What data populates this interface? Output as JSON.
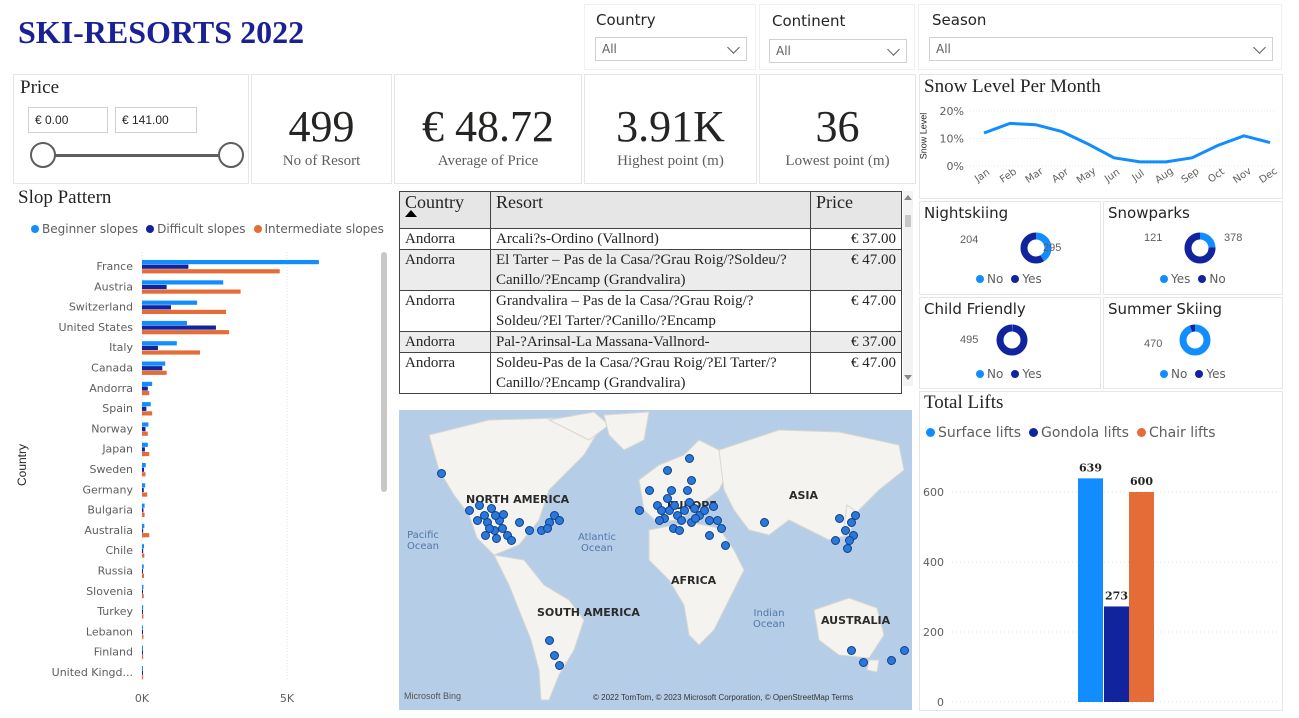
{
  "header": {
    "title": "SKI-RESORTS 2022"
  },
  "filters": [
    {
      "label": "Country",
      "value": "All"
    },
    {
      "label": "Continent",
      "value": "All"
    },
    {
      "label": "Season",
      "value": "All"
    }
  ],
  "price_slicer": {
    "label": "Price",
    "min": "€ 0.00",
    "max": "€ 141.00"
  },
  "kpis": [
    {
      "value": "499",
      "label": "No of Resort"
    },
    {
      "value": "€ 48.72",
      "label": "Average of Price"
    },
    {
      "value": "3.91K",
      "label": "Highest point (m)"
    },
    {
      "value": "36",
      "label": "Lowest point (m)"
    }
  ],
  "colors": {
    "beginner": "#118dff",
    "difficult": "#12239e",
    "intermediate": "#e66c37",
    "title": "#1a2196"
  },
  "slope_pattern": {
    "title": "Slop Pattern",
    "axis_label": "Country",
    "x_ticks": [
      "0K",
      "5K"
    ],
    "legend": [
      "Beginner slopes",
      "Difficult slopes",
      "Intermediate slopes"
    ]
  },
  "table": {
    "columns": [
      "Country",
      "Resort",
      "Price"
    ],
    "rows": [
      {
        "country": "Andorra",
        "resort": "Arcali?s-Ordino (Vallnord)",
        "price": "€ 37.00"
      },
      {
        "country": "Andorra",
        "resort": "El Tarter – Pas de la Casa/?Grau Roig/?Soldeu/?Canillo/?Encamp (Grandvalira)",
        "price": "€ 47.00"
      },
      {
        "country": "Andorra",
        "resort": "Grandvalira – Pas de la Casa/?Grau Roig/?Soldeu/?El Tarter/?Canillo/?Encamp",
        "price": "€ 47.00"
      },
      {
        "country": "Andorra",
        "resort": "Pal-?Arinsal-La Massana-Vallnord-",
        "price": "€ 37.00"
      },
      {
        "country": "Andorra",
        "resort": "Soldeu-Pas de la Casa/?Grau Roig/?El Tarter/?Canillo/?Encamp (Grandvalira)",
        "price": "€ 47.00"
      }
    ]
  },
  "map": {
    "continents": [
      "NORTH AMERICA",
      "EUROPE",
      "ASIA",
      "AFRICA",
      "SOUTH AMERICA",
      "AUSTRALIA"
    ],
    "oceans": [
      "Pacific Ocean",
      "Atlantic Ocean",
      "Indian Ocean"
    ],
    "brand": "Microsoft Bing",
    "attribution": "© 2022 TomTom, © 2023 Microsoft Corporation, © OpenStreetMap  Terms"
  },
  "snow_chart": {
    "title": "Snow Level Per Month",
    "ylabel": "Snow Level"
  },
  "donuts": [
    {
      "title": "Nightskiing",
      "left_value": "204",
      "right_value": "295",
      "legend": [
        "No",
        "Yes"
      ]
    },
    {
      "title": "Snowparks",
      "left_value": "121",
      "right_value": "378",
      "legend": [
        "Yes",
        "No"
      ]
    },
    {
      "title": "Child Friendly",
      "left_value": "495",
      "legend": [
        "No",
        "Yes"
      ]
    },
    {
      "title": "Summer Skiing",
      "left_value": "470",
      "legend": [
        "No",
        "Yes"
      ]
    }
  ],
  "lifts_chart": {
    "title": "Total Lifts",
    "legend": [
      "Surface lifts",
      "Gondola lifts",
      "Chair lifts"
    ]
  },
  "chart_data": [
    {
      "type": "bar",
      "orientation": "horizontal",
      "title": "Slop Pattern",
      "ylabel": "Country",
      "categories": [
        "France",
        "Austria",
        "Switzerland",
        "United States",
        "Italy",
        "Canada",
        "Andorra",
        "Spain",
        "Norway",
        "Japan",
        "Sweden",
        "Germany",
        "Bulgaria",
        "Australia",
        "Chile",
        "Russia",
        "Slovenia",
        "Turkey",
        "Lebanon",
        "Finland",
        "United Kingd..."
      ],
      "series": [
        {
          "name": "Beginner slopes",
          "values": [
            6100,
            2800,
            1900,
            1550,
            1200,
            800,
            350,
            300,
            220,
            200,
            130,
            110,
            90,
            80,
            70,
            60,
            50,
            40,
            30,
            30,
            20
          ]
        },
        {
          "name": "Difficult slopes",
          "values": [
            1600,
            850,
            1000,
            2550,
            550,
            700,
            200,
            150,
            120,
            100,
            70,
            60,
            50,
            40,
            40,
            30,
            30,
            20,
            20,
            20,
            10
          ]
        },
        {
          "name": "Intermediate slopes",
          "values": [
            4750,
            3400,
            2900,
            3000,
            2000,
            850,
            250,
            350,
            200,
            250,
            120,
            180,
            90,
            250,
            80,
            70,
            60,
            50,
            50,
            40,
            40
          ]
        }
      ],
      "xlim": [
        0,
        8000
      ],
      "x_ticks": [
        0,
        5000
      ],
      "legend": "top",
      "grid": true
    },
    {
      "type": "line",
      "title": "Snow Level Per Month",
      "ylabel": "Snow Level",
      "x": [
        "Jan",
        "Feb",
        "Mar",
        "Apr",
        "May",
        "Jun",
        "Jul",
        "Aug",
        "Sep",
        "Oct",
        "Nov",
        "Dec"
      ],
      "y": [
        12,
        15.5,
        15,
        12.5,
        8,
        3,
        1.5,
        1.5,
        3,
        7.5,
        11,
        8.5
      ],
      "y_ticks": [
        "0%",
        "10%",
        "20%"
      ],
      "ylim": [
        0,
        22
      ]
    },
    {
      "type": "bar",
      "title": "Total Lifts",
      "categories": [
        "Surface lifts",
        "Gondola lifts",
        "Chair lifts"
      ],
      "values": [
        639,
        273,
        600
      ],
      "y_ticks": [
        0,
        200,
        400,
        600
      ],
      "ylim": [
        0,
        700
      ],
      "legend": "top"
    }
  ]
}
